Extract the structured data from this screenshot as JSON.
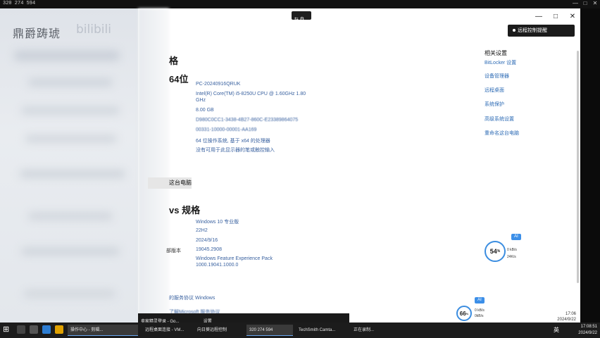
{
  "remote": {
    "id": "320 274 594",
    "pill_label": "⇆ ⚙"
  },
  "watermark": {
    "text": "鼎爵踌琥",
    "text2": "bilibili"
  },
  "window": {
    "minimize": "—",
    "maximize": "□",
    "close": "✕",
    "notify_button": "远程控制提醒"
  },
  "device": {
    "title": "格",
    "subtitle": "64位",
    "values": [
      "PC-20240916QRUK",
      "Intel(R) Core(TM) i5-8250U CPU @ 1.60GHz   1.80",
      "GHz",
      "8.00 GB",
      "D980C0CC1-3438-4B27-860C-E23389864075",
      "00331-10000-00001-AA169",
      "64 位操作系统, 基于 x64 的处理器",
      "没有可用于此显示器的笔或触控输入"
    ],
    "rename_button": "这台电脑"
  },
  "windows_spec": {
    "title": "vs 规格",
    "values": [
      "Windows 10 专业版",
      "22H2",
      "2024/9/16",
      "19045.2908",
      "Windows Feature Experience Pack",
      "1000.19041.1000.0"
    ],
    "label_fragment": "部版本",
    "footer_link": "的服务协议 Windows",
    "footer_link2": "了解Microsoft 服务协议"
  },
  "related": {
    "title": "相关设置",
    "links": [
      "BitLocker 设置",
      "设备管理器",
      "远程桌面",
      "系统保护",
      "高级系统设置",
      "重命名这台电脑"
    ]
  },
  "widgets": {
    "top": {
      "ai": "AI",
      "percent": "54",
      "unit": "%",
      "up": "0 kB/s",
      "down": "24K/s"
    },
    "bottom": {
      "ai": "AI",
      "percent": "66",
      "unit": "%",
      "up": "0 kB/s",
      "down": "0kB/s"
    }
  },
  "inner_clock": {
    "time": "17:06",
    "date": "2024/9/22"
  },
  "taskbar": {
    "start": "⊞",
    "items": [
      {
        "label": "操作中心 - 剪辑...",
        "active": true
      },
      {
        "label": "远程桌面连接 - VM...",
        "active": false
      },
      {
        "label": "向日葵远程控制",
        "active": false
      },
      {
        "label": "320 274 594",
        "active": true
      },
      {
        "label": "TechSmith Camta...",
        "active": false
      },
      {
        "label": "正在录制...",
        "active": false
      }
    ],
    "ime": "英",
    "time": "17:08:51",
    "date": "2024/9/22"
  },
  "inner_taskbar": {
    "items": [
      "卖家精灵登录 - Go...",
      "设置"
    ]
  },
  "colors": {
    "link": "#2d6bb5",
    "value": "#3a62a0",
    "accent": "#3b8de0",
    "taskbar": "#1c1c1c"
  }
}
